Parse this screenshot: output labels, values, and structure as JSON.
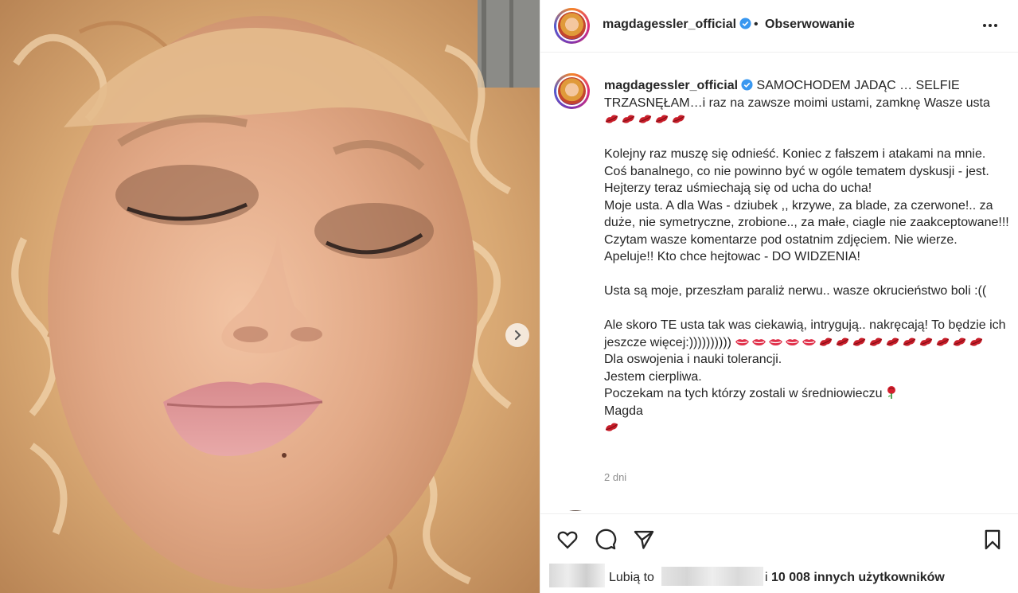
{
  "post": {
    "username": "magdagessler_official",
    "dot": "•",
    "follow_label": "Obserwowanie",
    "time_ago": "2 dni",
    "verified": true
  },
  "caption": {
    "username": "magdagessler_official",
    "line1": "SAMOCHODEM JADĄC … SELFIE TRZASNĘŁAM…i raz na zawsze moimi ustami, zamknę Wasze usta",
    "p2": [
      "Kolejny raz muszę się odnieść. Koniec z fałszem i atakami na mnie. Coś banalnego, co nie powinno być w ogóle tematem dyskusji - jest. Hejterzy teraz uśmiechają się od ucha do ucha!",
      "Moje usta. A dla Was - dziubek ,, krzywe, za blade, za czerwone!.. za duże, nie symetryczne, zrobione.., za małe, ciagle nie zaakceptowane!!!",
      "Czytam wasze komentarze pod ostatnim zdjęciem. Nie wierze.",
      "Apeluje!! Kto chce hejtowac - DO WIDZENIA!"
    ],
    "p3": "Usta są moje, przeszłam paraliż nerwu.. wasze okrucieństwo boli :((",
    "p4": "Ale skoro TE usta tak was ciekawią, intrygują.. nakręcają! To będzie ich jeszcze więcej:))))))))))",
    "p5": "Dla oswojenia i nauki tolerancji.",
    "p6": "Jestem cierpliwa.",
    "p7": "Poczekam na tych którzy zostali w średniowieczu",
    "p8": "Magda"
  },
  "likes": {
    "prefix": "Lubią to",
    "suffix_pre": "i",
    "count_label": "10 008 innych użytkowników"
  },
  "icons": {
    "more": "more-options-icon",
    "like": "heart-icon",
    "comment": "comment-icon",
    "share": "share-icon",
    "save": "bookmark-icon",
    "next": "chevron-right-icon",
    "verified": "verified-badge-icon",
    "emoji_kiss": "kiss-mark",
    "emoji_lips": "mouth",
    "emoji_rose": "rose"
  },
  "colors": {
    "text": "#262626",
    "muted": "#8e8e8e",
    "verified": "#3897f0",
    "divider": "#efefef",
    "lips": "#c81e2a"
  }
}
